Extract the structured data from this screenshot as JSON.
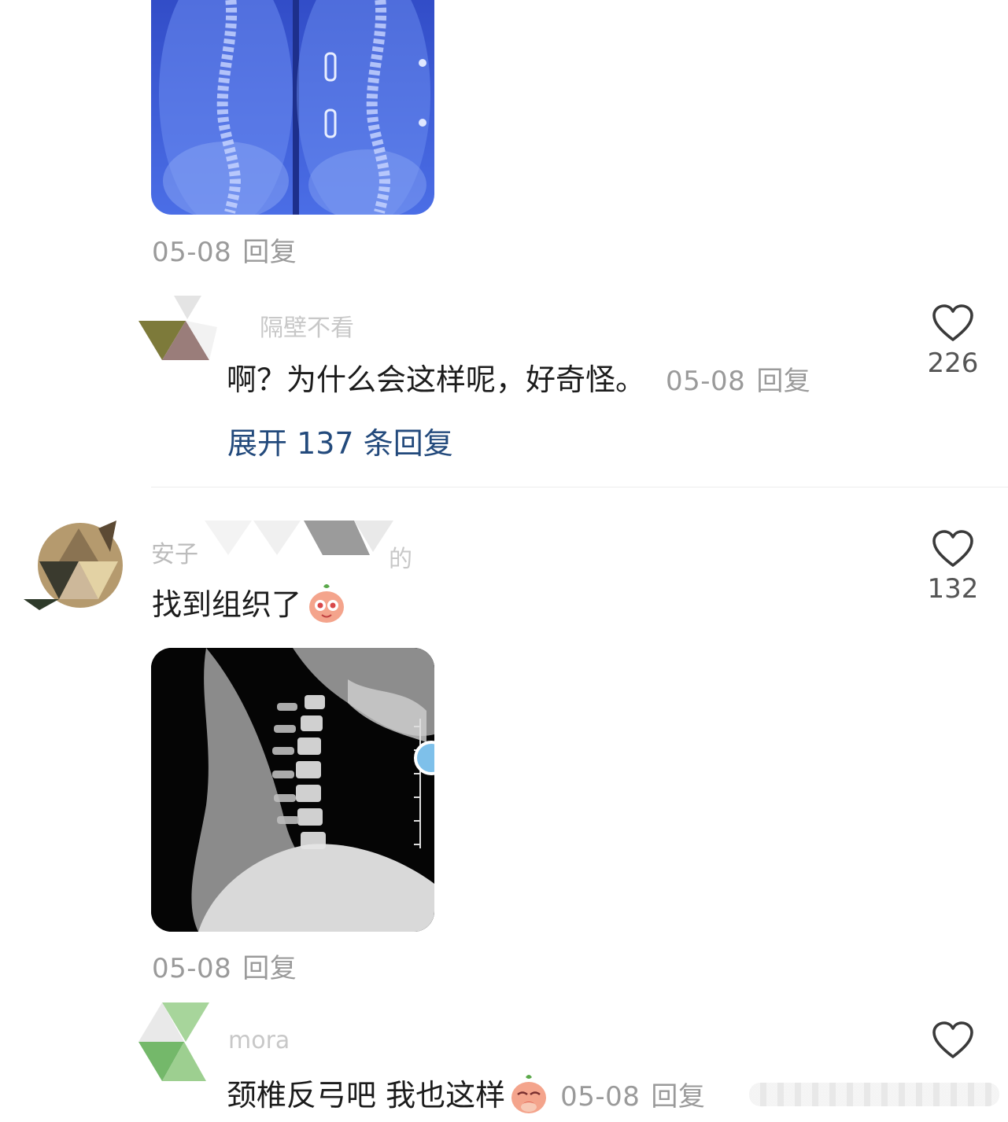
{
  "comments": {
    "top_image_comment": {
      "image_label": "spine x-ray image",
      "date": "05-08",
      "reply_label": "回复"
    },
    "sub_reply_1": {
      "username": "隔壁不看",
      "text": "啊？为什么会这样呢，好奇怪。",
      "date": "05-08",
      "reply_label": "回复",
      "likes": "226"
    },
    "expand": {
      "label": "展开 137 条回复"
    },
    "comment_2": {
      "username": "安子",
      "username_suffix": "的",
      "text": "找到组织了",
      "image_label": "neck x-ray image",
      "date": "05-08",
      "reply_label": "回复",
      "likes": "132"
    },
    "sub_reply_2": {
      "username": "mora",
      "text": "颈椎反弓吧 我也这样",
      "date": "05-08",
      "reply_label": "回复"
    }
  },
  "colors": {
    "link": "#234a7c",
    "meta": "#9a9a9a",
    "text": "#1c1c1c",
    "xray_blue": "#3d5fd8"
  },
  "icons": [
    "heart-outline-icon",
    "blush-emoji-icon",
    "shy-emoji-icon"
  ]
}
